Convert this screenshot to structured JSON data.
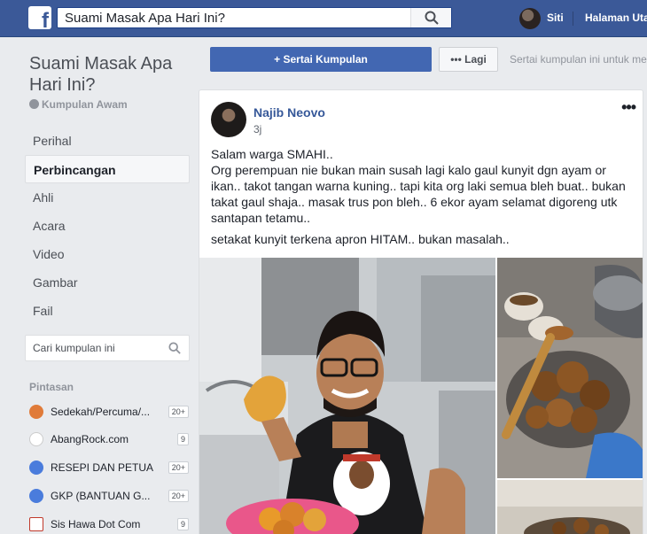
{
  "topbar": {
    "logo_letter": "f",
    "search_value": "Suami Masak Apa Hari Ini?",
    "profile_name": "Siti",
    "home_link": "Halaman Utama"
  },
  "sidebar": {
    "group_name": "Suami Masak Apa Hari Ini?",
    "group_type": "Kumpulan Awam",
    "nav": [
      "Perihal",
      "Perbincangan",
      "Ahli",
      "Acara",
      "Video",
      "Gambar",
      "Fail"
    ],
    "active_index": 1,
    "search_placeholder": "Cari kumpulan ini",
    "shortcuts_title": "Pintasan",
    "shortcuts": [
      {
        "label": "Sedekah/Percuma/...",
        "count": "20+",
        "icon": "group-photo-icon",
        "color": "#e07b39"
      },
      {
        "label": "AbangRock.com",
        "count": "9",
        "icon": "page-logo-icon",
        "color": "#222222"
      },
      {
        "label": "RESEPI DAN PETUA",
        "count": "20+",
        "icon": "group-icon",
        "color": "#4a7cdc"
      },
      {
        "label": "GKP (BANTUAN G...",
        "count": "20+",
        "icon": "group-icon",
        "color": "#4a7cdc"
      },
      {
        "label": "Sis Hawa Dot Com",
        "count": "9",
        "icon": "page-logo-icon",
        "color": "#c0392b"
      }
    ]
  },
  "header": {
    "join_label": "Sertai Kumpulan",
    "join_icon": "plus-icon",
    "more_label": "Lagi",
    "more_icon": "ellipsis-icon",
    "join_hint": "Sertai kumpulan ini untuk mel"
  },
  "post": {
    "author": "Najib Neovo",
    "time": "3j",
    "menu_glyph": "•••",
    "paragraphs": [
      "Salam warga SMAHI..",
      "Org perempuan nie bukan main susah lagi kalo gaul kunyit dgn ayam or ikan.. takot tangan warna kuning.. tapi kita org laki semua bleh buat.. bukan takat gaul shaja.. masak trus pon bleh.. 6 ekor ayam selamat digoreng utk santapan tetamu..",
      "setakat kunyit terkena apron HITAM.. bukan masalah.."
    ],
    "photos": [
      "man-cooking-photo",
      "fried-chicken-photo",
      "cooking-photo"
    ]
  },
  "colors": {
    "topbar": "#3b5998",
    "accent": "#4267b2",
    "link": "#365899",
    "background": "#e9ebee"
  }
}
